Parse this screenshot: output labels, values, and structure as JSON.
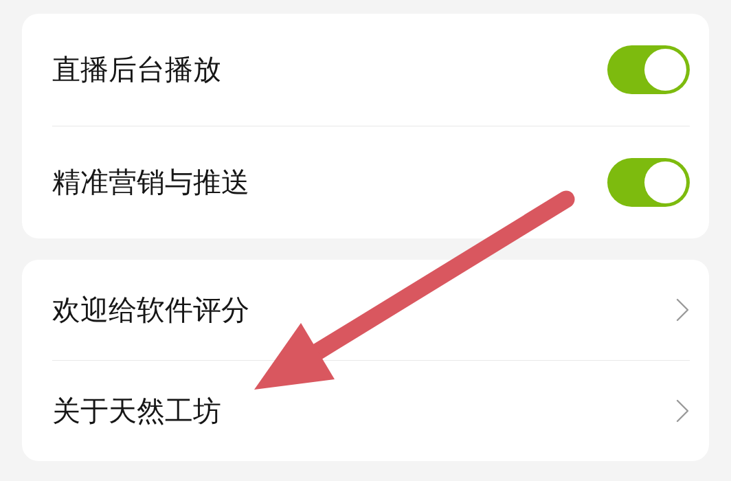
{
  "sections": [
    {
      "items": [
        {
          "label": "直播后台播放",
          "kind": "toggle",
          "on": true
        },
        {
          "label": "精准营销与推送",
          "kind": "toggle",
          "on": true
        }
      ]
    },
    {
      "items": [
        {
          "label": "欢迎给软件评分",
          "kind": "link"
        },
        {
          "label": "关于天然工坊",
          "kind": "link"
        }
      ]
    }
  ]
}
